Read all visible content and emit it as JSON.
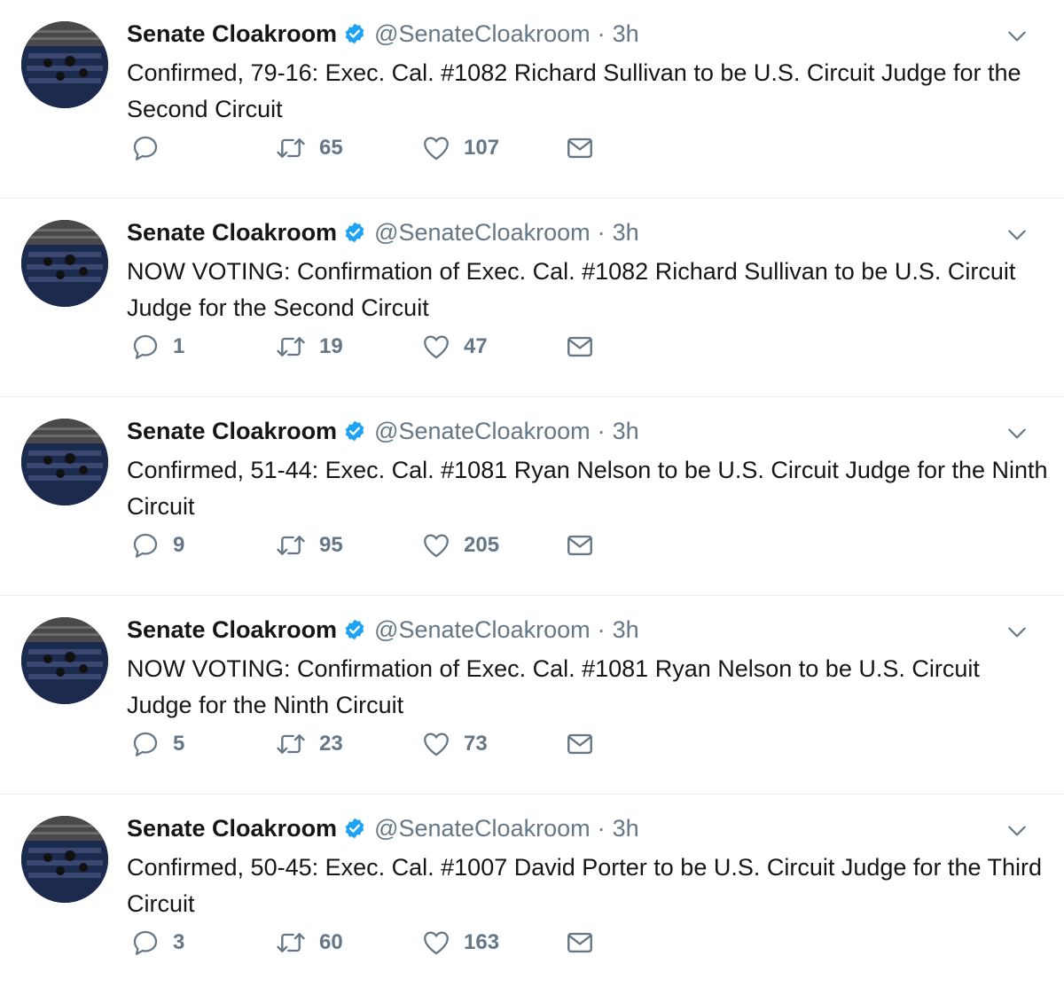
{
  "colors": {
    "verified": "#1da1f2",
    "muted": "#657786",
    "text": "#14171a",
    "divider": "#e6ecf0"
  },
  "icons": {
    "reply": "reply-icon",
    "retweet": "retweet-icon",
    "like": "heart-icon",
    "dm": "envelope-icon",
    "verified": "verified-badge-icon",
    "menu": "chevron-down-icon"
  },
  "tweets": [
    {
      "name": "Senate Cloakroom",
      "handle": "@SenateCloakroom",
      "separator": "·",
      "time": "3h",
      "text": "Confirmed, 79-16: Exec. Cal. #1082 Richard Sullivan to be U.S. Circuit Judge for the Second Circuit",
      "replies": "",
      "retweets": "65",
      "likes": "107"
    },
    {
      "name": "Senate Cloakroom",
      "handle": "@SenateCloakroom",
      "separator": "·",
      "time": "3h",
      "text": "NOW VOTING: Confirmation of Exec. Cal. #1082 Richard Sullivan to be U.S. Circuit Judge for the Second Circuit",
      "replies": "1",
      "retweets": "19",
      "likes": "47"
    },
    {
      "name": "Senate Cloakroom",
      "handle": "@SenateCloakroom",
      "separator": "·",
      "time": "3h",
      "text": "Confirmed, 51-44: Exec. Cal. #1081 Ryan Nelson to be U.S. Circuit Judge for the Ninth Circuit",
      "replies": "9",
      "retweets": "95",
      "likes": "205"
    },
    {
      "name": "Senate Cloakroom",
      "handle": "@SenateCloakroom",
      "separator": "·",
      "time": "3h",
      "text": "NOW VOTING: Confirmation of Exec. Cal. #1081 Ryan Nelson to be U.S. Circuit Judge for the Ninth Circuit",
      "replies": "5",
      "retweets": "23",
      "likes": "73"
    },
    {
      "name": "Senate Cloakroom",
      "handle": "@SenateCloakroom",
      "separator": "·",
      "time": "3h",
      "text": "Confirmed, 50-45: Exec. Cal. #1007 David Porter to be U.S. Circuit Judge for the Third Circuit",
      "replies": "3",
      "retweets": "60",
      "likes": "163"
    }
  ]
}
